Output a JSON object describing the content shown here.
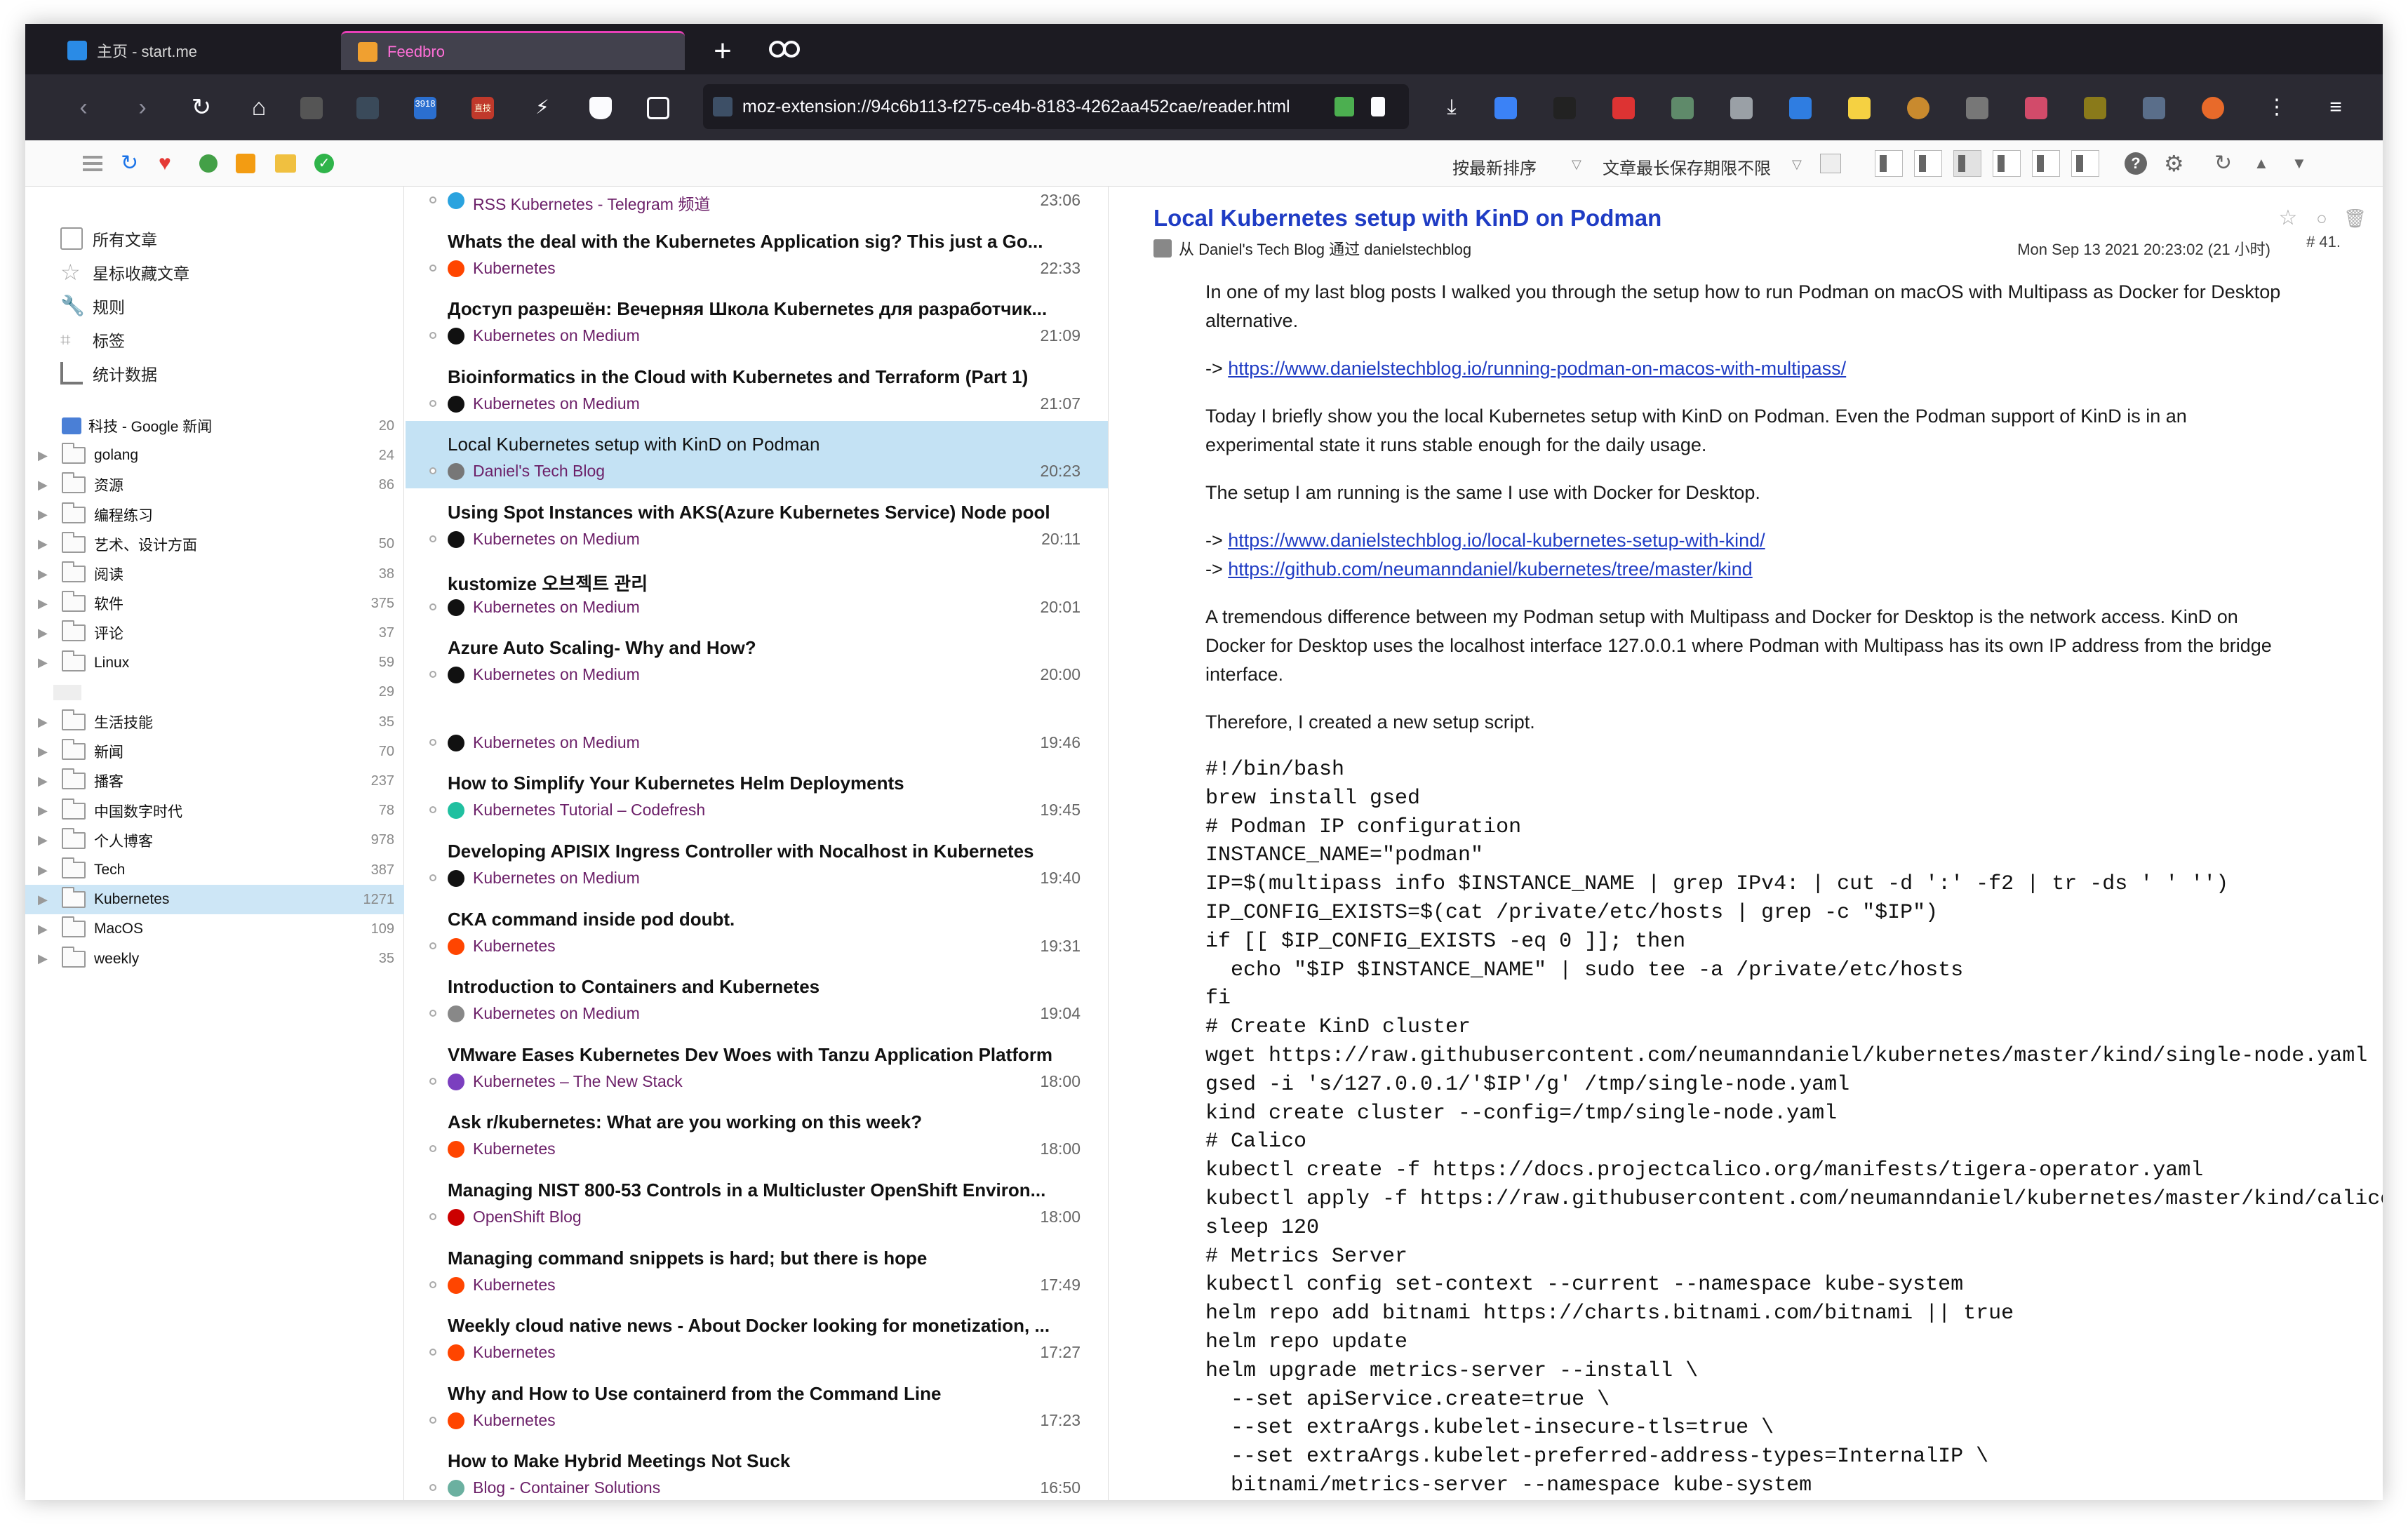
{
  "tabs": [
    {
      "label": "主页 - start.me"
    },
    {
      "label": "Feedbro"
    }
  ],
  "urlbar": {
    "url": "moz-extension://94c6b113-f275-ce4b-8183-4262aa452cae/reader.html"
  },
  "extensions": {
    "badge_count": "3918",
    "badge_text": "直技"
  },
  "toolbar": {
    "sort_label": "按最新排序",
    "retention_label": "文章最长保存期限不限"
  },
  "sidebar": {
    "top_items": [
      {
        "label": "所有文章",
        "icon": "articles-icon"
      },
      {
        "label": "星标收藏文章",
        "icon": "star-icon"
      },
      {
        "label": "规则",
        "icon": "wrench-icon"
      },
      {
        "label": "标签",
        "icon": "tag-icon"
      },
      {
        "label": "统计数据",
        "icon": "chart-icon"
      }
    ],
    "folders": [
      {
        "name": "科技 - Google 新闻",
        "count": "20",
        "type": "gnews"
      },
      {
        "name": "golang",
        "count": "24"
      },
      {
        "name": "资源",
        "count": "86"
      },
      {
        "name": "编程练习",
        "count": ""
      },
      {
        "name": "艺术、设计方面",
        "count": "50"
      },
      {
        "name": "阅读",
        "count": "38"
      },
      {
        "name": "软件",
        "count": "375"
      },
      {
        "name": "评论",
        "count": "37"
      },
      {
        "name": "Linux",
        "count": "59"
      },
      {
        "name": "",
        "count": "29",
        "type": "blank"
      },
      {
        "name": "生活技能",
        "count": "35"
      },
      {
        "name": "新闻",
        "count": "70"
      },
      {
        "name": "播客",
        "count": "237"
      },
      {
        "name": "中国数字时代",
        "count": "78"
      },
      {
        "name": "个人博客",
        "count": "978"
      },
      {
        "name": "Tech",
        "count": "387"
      },
      {
        "name": "Kubernetes",
        "count": "1271",
        "selected": true
      },
      {
        "name": "MacOS",
        "count": "109"
      },
      {
        "name": "weekly",
        "count": "35"
      }
    ]
  },
  "articles": [
    {
      "title": "",
      "source": "RSS Kubernetes - Telegram 频道",
      "time": "23:06",
      "icon_color": "#2aa3df",
      "partial": true
    },
    {
      "title": "Whats the deal with the Kubernetes Application sig? This just a Go...",
      "source": "Kubernetes",
      "time": "22:33",
      "icon_color": "#ff4500"
    },
    {
      "title": "Доступ разрешён: Вечерняя Школа Kubernetes для разработчик...",
      "source": "Kubernetes on Medium",
      "time": "21:09",
      "icon_color": "#111111"
    },
    {
      "title": "Bioinformatics in the Cloud with Kubernetes and Terraform (Part 1)",
      "source": "Kubernetes on Medium",
      "time": "21:07",
      "icon_color": "#111111"
    },
    {
      "title": "Local Kubernetes setup with KinD on Podman",
      "source": "Daniel's Tech Blog",
      "time": "20:23",
      "icon_color": "#777777",
      "selected": true
    },
    {
      "title": "Using Spot Instances with AKS(Azure Kubernetes Service) Node pool",
      "source": "Kubernetes on Medium",
      "time": "20:11",
      "icon_color": "#111111"
    },
    {
      "title": "kustomize 오브젝트 관리",
      "source": "Kubernetes on Medium",
      "time": "20:01",
      "icon_color": "#111111"
    },
    {
      "title": "Azure Auto Scaling- Why and How?",
      "source": "Kubernetes on Medium",
      "time": "20:00",
      "icon_color": "#111111"
    },
    {
      "title": "",
      "source": "Kubernetes on Medium",
      "time": "19:46",
      "icon_color": "#111111"
    },
    {
      "title": "How to Simplify Your Kubernetes Helm Deployments",
      "source": "Kubernetes Tutorial – Codefresh",
      "time": "19:45",
      "icon_color": "#20c0a0"
    },
    {
      "title": "Developing APISIX Ingress Controller with Nocalhost in Kubernetes",
      "source": "Kubernetes on Medium",
      "time": "19:40",
      "icon_color": "#111111"
    },
    {
      "title": "CKA command inside pod doubt.",
      "source": "Kubernetes",
      "time": "19:31",
      "icon_color": "#ff4500"
    },
    {
      "title": "Introduction to Containers and Kubernetes",
      "source": "Kubernetes on Medium",
      "time": "19:04",
      "icon_color": "#888888"
    },
    {
      "title": "VMware Eases Kubernetes Dev Woes with Tanzu Application Platform",
      "source": "Kubernetes – The New Stack",
      "time": "18:00",
      "icon_color": "#7b3fbf"
    },
    {
      "title": "Ask r/kubernetes: What are you working on this week?",
      "source": "Kubernetes",
      "time": "18:00",
      "icon_color": "#ff4500"
    },
    {
      "title": "Managing NIST 800-53 Controls in a Multicluster OpenShift Environ...",
      "source": "OpenShift Blog",
      "time": "18:00",
      "icon_color": "#cc0000"
    },
    {
      "title": "Managing command snippets is hard; but there is hope",
      "source": "Kubernetes",
      "time": "17:49",
      "icon_color": "#ff4500"
    },
    {
      "title": "Weekly cloud native news - About Docker looking for monetization, ...",
      "source": "Kubernetes",
      "time": "17:27",
      "icon_color": "#ff4500"
    },
    {
      "title": "Why and How to Use containerd from the Command Line",
      "source": "Kubernetes",
      "time": "17:23",
      "icon_color": "#ff4500"
    },
    {
      "title": "How to Make Hybrid Meetings Not Suck",
      "source": "Blog - Container Solutions",
      "time": "16:50",
      "icon_color": "#6bb0a0"
    }
  ],
  "article": {
    "title": "Local Kubernetes setup with KinD on Podman",
    "byline": "从 Daniel's Tech Blog 通过 danielstechblog",
    "date": "Mon Sep 13 2021 20:23:02 (21 小时)",
    "number": "# 41.",
    "p1": "In one of my last blog posts I walked you through the setup how to run Podman on macOS with Multipass as Docker for Desktop alternative.",
    "link1_prefix": "-> ",
    "link1": "https://www.danielstechblog.io/running-podman-on-macos-with-multipass/",
    "p2": "Today I briefly show you the local Kubernetes setup with KinD on Podman. Even the Podman support of KinD is in an experimental state it runs stable enough for the daily usage.",
    "p3": "The setup I am running is the same I use with Docker for Desktop.",
    "link2_prefix": "-> ",
    "link2": "https://www.danielstechblog.io/local-kubernetes-setup-with-kind/",
    "link3_prefix": "-> ",
    "link3": "https://github.com/neumanndaniel/kubernetes/tree/master/kind",
    "p4": "A tremendous difference between my Podman setup with Multipass and Docker for Desktop is the network access. KinD on Docker for Desktop uses the localhost interface 127.0.0.1 where Podman with Multipass has its own IP address from the bridge interface.",
    "p5": "Therefore, I created a new setup script.",
    "code": "#!/bin/bash\nbrew install gsed\n# Podman IP configuration\nINSTANCE_NAME=\"podman\"\nIP=$(multipass info $INSTANCE_NAME | grep IPv4: | cut -d ':' -f2 | tr -ds ' ' '')\nIP_CONFIG_EXISTS=$(cat /private/etc/hosts | grep -c \"$IP\")\nif [[ $IP_CONFIG_EXISTS -eq 0 ]]; then\n  echo \"$IP $INSTANCE_NAME\" | sudo tee -a /private/etc/hosts\nfi\n# Create KinD cluster\nwget https://raw.githubusercontent.com/neumanndaniel/kubernetes/master/kind/single-node.yaml -O /\ngsed -i 's/127.0.0.1/'$IP'/g' /tmp/single-node.yaml\nkind create cluster --config=/tmp/single-node.yaml\n# Calico\nkubectl create -f https://docs.projectcalico.org/manifests/tigera-operator.yaml\nkubectl apply -f https://raw.githubusercontent.com/neumanndaniel/kubernetes/master/kind/calico-cc\nsleep 120\n# Metrics Server\nkubectl config set-context --current --namespace kube-system\nhelm repo add bitnami https://charts.bitnami.com/bitnami || true\nhelm repo update\nhelm upgrade metrics-server --install \\\n  --set apiService.create=true \\\n  --set extraArgs.kubelet-insecure-tls=true \\\n  --set extraArgs.kubelet-preferred-address-types=InternalIP \\\n  bitnami/metrics-server --namespace kube-system"
  }
}
